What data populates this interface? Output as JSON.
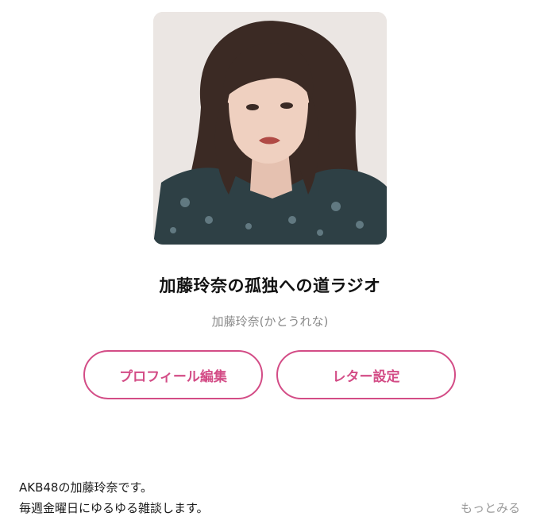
{
  "podcast": {
    "title": "加藤玲奈の孤独への道ラジオ",
    "author": "加藤玲奈(かとうれな)"
  },
  "buttons": {
    "profile_edit": "プロフィール編集",
    "letter_settings": "レター設定"
  },
  "description": {
    "line1": "AKB48の加藤玲奈です。",
    "line2": "毎週金曜日にゆるゆる雑談します。",
    "more_label": "もっとみる"
  },
  "colors": {
    "accent": "#d34c86",
    "muted_text": "#8a8a8a"
  }
}
